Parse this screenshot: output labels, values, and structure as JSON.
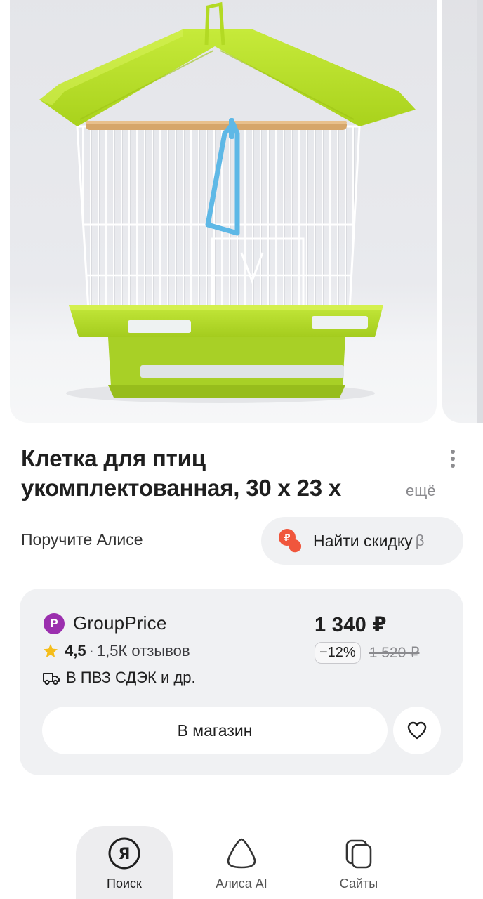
{
  "product": {
    "title_line1": "Клетка для птиц",
    "title_line2": "укомплектованная, 30 х 23 х",
    "more_label": "ещё"
  },
  "alice": {
    "hint": "Поручите Алисе",
    "discount_button": "Найти скидку",
    "beta_mark": "β"
  },
  "offer": {
    "shop_logo_letter": "P",
    "shop_name": "GroupPrice",
    "rating": "4,5",
    "rating_separator": "·",
    "reviews": "1,5К отзывов",
    "delivery": "В ПВЗ СДЭК и др.",
    "price": "1 340 ₽",
    "discount": "−12%",
    "old_price": "1 520 ₽",
    "shop_button": "В магазин"
  },
  "nav": {
    "items": [
      {
        "label": "Поиск",
        "icon": "yandex-search-icon",
        "active": true
      },
      {
        "label": "Алиса AI",
        "icon": "alice-icon",
        "active": false
      },
      {
        "label": "Сайты",
        "icon": "sites-icon",
        "active": false
      }
    ]
  },
  "colors": {
    "cage_green": "#b9e02a",
    "card_bg": "#f0f1f3",
    "shop_logo": "#9b2fae",
    "discount_icon": "#f0563c",
    "star": "#f5bd1a"
  }
}
